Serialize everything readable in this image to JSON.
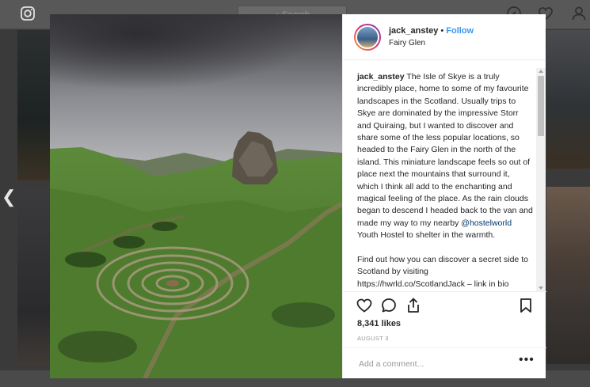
{
  "background": {
    "search_placeholder": "Search"
  },
  "post": {
    "username": "jack_anstey",
    "separator": "•",
    "follow_label": "Follow",
    "location": "Fairy Glen",
    "caption_username": "jack_anstey",
    "caption_text_1": " The Isle of Skye is a truly incredibly place, home to some of my favourite landscapes in the Scotland. Usually trips to Skye are dominated by the impressive Storr and Quiraing, but I wanted to discover and share some of the less popular locations, so headed to the Fairy Glen in the north of the island. This miniature landscape feels so out of place next the mountains that surround it, which I think all add to the enchanting and magical feeling of the place. As the rain clouds began to descend I headed back to the van and made my way to my nearby ",
    "caption_mention": "@hostelworld",
    "caption_text_2": " Youth Hostel to shelter in the warmth.",
    "caption_para_2": "Find out how you can discover a secret side to Scotland by visiting https://hwrld.co/ScotlandJack – link in bio",
    "likes": "8,341 likes",
    "date": "AUGUST 3",
    "comment_placeholder": "Add a comment...",
    "more_label": "•••"
  },
  "icons": [
    "instagram-icon",
    "compass-icon",
    "heart-icon",
    "user-icon",
    "chevron-left-icon",
    "like-icon",
    "comment-icon",
    "share-icon",
    "bookmark-icon",
    "more-icon"
  ],
  "colors": {
    "accent": "#3897f0",
    "text": "#262626",
    "muted": "#999999"
  }
}
